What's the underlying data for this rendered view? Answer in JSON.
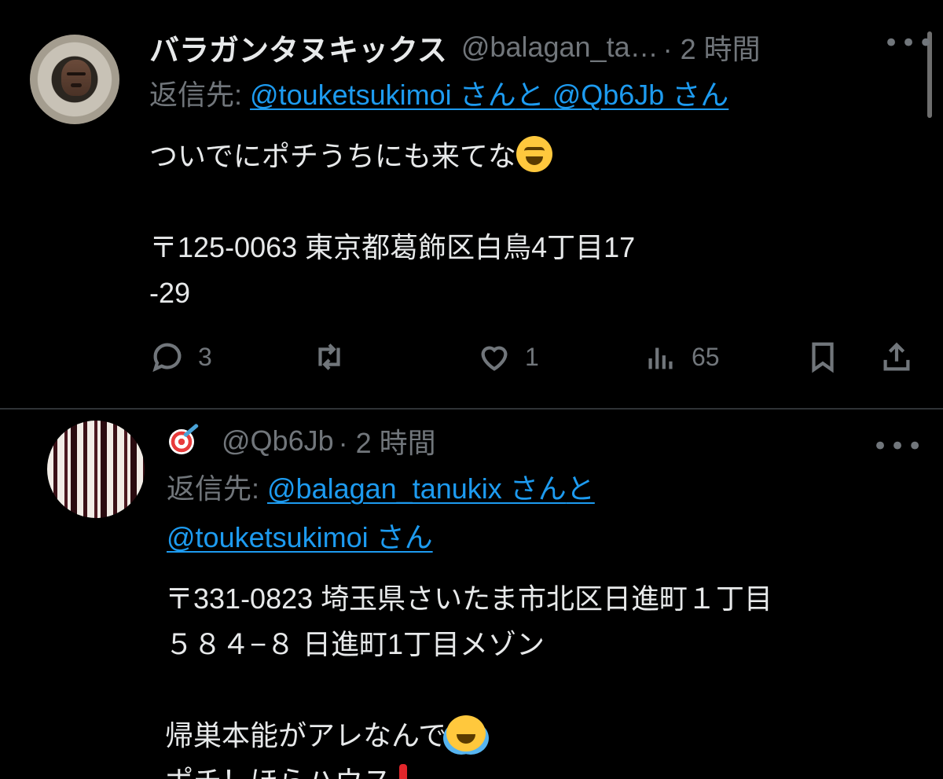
{
  "tweets": [
    {
      "display_name": "バラガンタヌキックス",
      "handle": "@balagan_ta…",
      "meta": "· 2 時間",
      "more": "•••",
      "reply_prefix": "返信先: ",
      "reply_users": [
        "@touketsukimoi さん",
        "@Qb6Jb さん"
      ],
      "reply_joiner": "と ",
      "body_lines": [
        "ついでにポチうちにも来てな",
        "",
        "〒125-0063 東京都葛飾区白鳥4丁目17",
        "-29"
      ],
      "counts": {
        "replies": "3",
        "retweets": "",
        "likes": "1",
        "views": "65"
      }
    },
    {
      "handle": "@Qb6Jb",
      "meta": "· 2 時間",
      "more": "•••",
      "reply_prefix": "返信先: ",
      "reply_users": [
        "@balagan_tanukix さん",
        "@touketsukimoi さん"
      ],
      "reply_joiner": "と",
      "body_lines": [
        "〒331-0823 埼玉県さいたま市北区日進町１丁目",
        "５８４−８ 日進町1丁目メゾン",
        "",
        "帰巣本能がアレなんで",
        "ポチ！ほらハウス"
      ]
    }
  ],
  "icons": {
    "reply": "reply-bubble-icon",
    "retweet": "retweet-icon",
    "like": "heart-icon",
    "views": "views-chart-icon",
    "bookmark": "bookmark-icon",
    "share": "share-icon",
    "more": "more-dots-icon"
  },
  "colors": {
    "background": "#000000",
    "text": "#e7e9ea",
    "secondary": "#71767b",
    "link": "#1d9bf0",
    "divider": "#2f3336"
  }
}
